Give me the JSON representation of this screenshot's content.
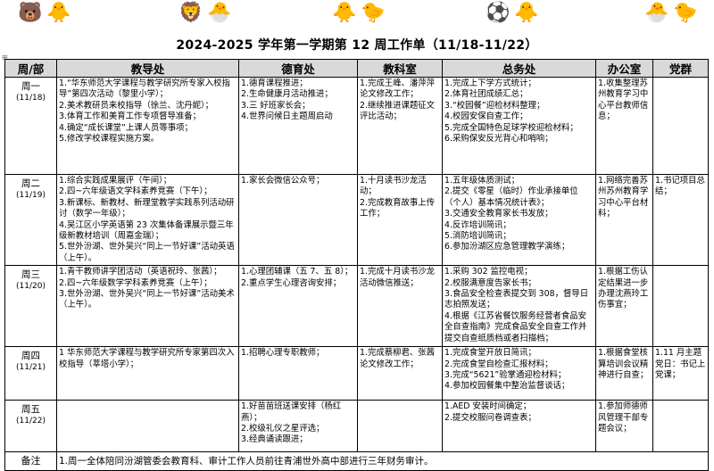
{
  "title": "2024-2025 学年第一学期第 12 周工作单（11/18-11/22）",
  "headers": [
    "周/部",
    "教导处",
    "德育处",
    "教科室",
    "总务处",
    "办公室",
    "党群"
  ],
  "days": [
    {
      "day": "周一",
      "date": "(11/18)",
      "jiaodao": [
        "1.“华东师范大学课程与教学研究所专家入校指导”第四次活动（黎里小学）；",
        "2.美术教研员来校指导（徐兰、沈丹妮）；",
        "3.体育工作和美育工作专项督导准备；",
        "4.确定“成长课堂”上课人员等事项；",
        "5.修改学校课程实施方案。"
      ],
      "deyu": [
        "1.德育课程推进；",
        "2.生命健康月活动推进；",
        "3.三 好班家长会；",
        "4.世界问候日主题周启动"
      ],
      "jiaoke": [
        "1.完成王峰、潘萍萍论文修改工作；",
        "2.继续推进课题征文评比活动；"
      ],
      "zongwu": [
        "1.完成上下学方式统计；",
        "2.体育社团成绩汇总；",
        "3.“校园餐”迎检材料整理；",
        "4.校园安保自查工作；",
        "5.完成全国特色足球学校迎检材料；",
        "6.采购保安反光背心和哨响；"
      ],
      "bangong": [
        "1.收集整理苏州教育学习中心平台教师信息；"
      ],
      "dangqun": []
    },
    {
      "day": "周二",
      "date": "(11/19)",
      "jiaodao": [
        "1.综合实践成果展评（午间）；",
        "2.四~六年级语文学科素养竞赛（下午）；",
        "3.新课标、新教材、新理堂教学实践系列活动研讨（数学一年级）；",
        "4.吴江区小学英语第 23 次集体备课展示暨三年级新教材培训（周嘉金瑞）；",
        "5.世外汾湖、世外吴兴“同上一节好课”活动英语（上午）。"
      ],
      "deyu": [
        "1.家长会微信公众号；"
      ],
      "jiaoke": [
        "1.十月读书沙龙活动；",
        "2.完成教育故事上传工作；"
      ],
      "zongwu": [
        "1.五年级体质测试；",
        "2.提交《零星（临时）作业承接单位（个人）基本情况统计表》；",
        "3.交通安全教育家长书发放；",
        "4.反诈培训简讯；",
        "5.消防培训简讯；",
        "6.参加汾湖区应急管理教学演练；"
      ],
      "bangong": [
        "1.网络完善苏州苏州教育学习中心平台材料；"
      ],
      "dangqun": [
        "1.书记项目总结；"
      ]
    },
    {
      "day": "周三",
      "date": "(11/20)",
      "jiaodao": [
        "1.青干教师讲学团活动（英语祝玲、张茜）；",
        "2.四~六年级数学学科素养竞赛（上午）；",
        "3.世外汾湖、世外吴兴“同上一节好课”活动美术（上午）。"
      ],
      "deyu": [
        "1.心理团辅课（五 7、五 8）；",
        "2.重点学生心理咨询安排；"
      ],
      "jiaoke": [
        "1.完成十月读书沙龙活动微信推送；"
      ],
      "zongwu": [
        "1.采购 302 监控电视；",
        "2.校服满意度告家长书；",
        "3.食品安全检查表提交到 308，督导日志拍照发送；",
        "4.根据《江苏省餐饮服务经营者食品安全自查指南》完成食品安全自查工作并提交自查纸质档或者扫描档；"
      ],
      "bangong": [
        "1.根据工伤认定结果进一步办理沈燕玲工伤事宜；"
      ],
      "dangqun": []
    },
    {
      "day": "周四",
      "date": "(11/21)",
      "jiaodao": [
        "1 华东师范大学课程与教学研究所专家第四次入校指导（莘塔小学）；"
      ],
      "deyu": [
        "1.招聘心理专职教师；"
      ],
      "jiaoke": [
        "1.完成蔡柳君、张茜论文修改工作；"
      ],
      "zongwu": [
        "1.完成食堂开放日简讯；",
        "2.完成食堂自检查汇报材料；",
        "3.完成“5621”验掌通迎检材料；",
        "4.参加校园餐集中整治监督谈话；"
      ],
      "bangong": [
        "1.根据食堂核算培训会议精神进行自查；"
      ],
      "dangqun": [
        "1.11 月主题党日：书记上党课；"
      ]
    },
    {
      "day": "周五",
      "date": "(11/22)",
      "jiaodao": [],
      "deyu": [
        "1.好苗苗班送课安排（杨红燕）；",
        "2.校级礼仪之星评选；",
        "3.经典诵读跟进；"
      ],
      "jiaoke": [],
      "zongwu": [
        "1.AED 安装时间确定；",
        "2.提交校服问卷调查表；"
      ],
      "bangong": [
        "1.参加师德师风管理干部专题会议；"
      ],
      "dangqun": []
    }
  ],
  "note_label": "备注",
  "note_text": "1.周一全体陪同汾湖管委会教育科、审计工作人员前往青浦世外高中部进行三年财务审计。"
}
